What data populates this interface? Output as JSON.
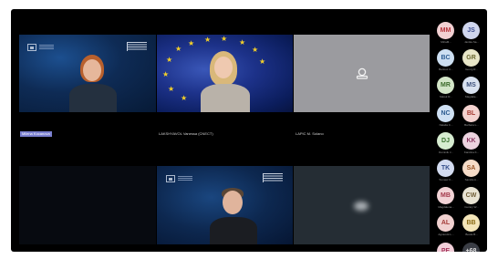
{
  "tiles": {
    "row1": [
      {
        "name": "Milena Kocanova"
      },
      {
        "name": "LAKSHYAVOL Vanessa (CNECT)"
      },
      {
        "name": "LAPIC M. Solano"
      }
    ]
  },
  "participants": [
    {
      "initials": "MM",
      "name": "MiriaM...",
      "color": "#f2d0d2",
      "text": "#b5323a"
    },
    {
      "initials": "JS",
      "name": "Jantka Sa...",
      "color": "#cfd6ee",
      "text": "#3a4a8c"
    },
    {
      "initials": "BC",
      "name": "Bartosz C...",
      "color": "#cddff2",
      "text": "#2d5d94"
    },
    {
      "initials": "GR",
      "name": "Georg R...",
      "color": "#e8e6c8",
      "text": "#6a6730"
    },
    {
      "initials": "MR",
      "name": "Marek R...",
      "color": "#d3e6c8",
      "text": "#3b6a2a"
    },
    {
      "initials": "MS",
      "name": "Magdale...",
      "color": "#d9e2f0",
      "text": "#3b4f7a"
    },
    {
      "initials": "NC",
      "name": "Natalia C...",
      "color": "#cfe0f3",
      "text": "#2b5a8f"
    },
    {
      "initials": "BL",
      "name": "Barbara L...",
      "color": "#f4d2cf",
      "text": "#a53b32"
    },
    {
      "initials": "DJ",
      "name": "Dominik J...",
      "color": "#d6ecd0",
      "text": "#3a7130"
    },
    {
      "initials": "KK",
      "name": "Karolina K...",
      "color": "#ecd3df",
      "text": "#8a3560"
    },
    {
      "initials": "TK",
      "name": "Tomasz K...",
      "color": "#d3dbf0",
      "text": "#354e8a"
    },
    {
      "initials": "SA",
      "name": "Sandra A...",
      "color": "#f6dcc8",
      "text": "#9a5526"
    },
    {
      "initials": "MB",
      "name": "Magdalena...",
      "color": "#f2d3d6",
      "text": "#a3384a"
    },
    {
      "initials": "CW",
      "name": "Cezary W...",
      "color": "#e8e3d3",
      "text": "#6e5c36"
    },
    {
      "initials": "AL",
      "name": "Agnieszk L...",
      "color": "#f1d1d0",
      "text": "#a33a36"
    },
    {
      "initials": "BB",
      "name": "Beata B...",
      "color": "#f3e5b8",
      "text": "#8a6a14"
    },
    {
      "initials": "PE",
      "name": "Piotr E...",
      "color": "#f2d0da",
      "text": "#a3355b"
    },
    {
      "initials": "+68",
      "name": "",
      "color": "#3a3d45",
      "text": "#e0e0e0"
    }
  ]
}
